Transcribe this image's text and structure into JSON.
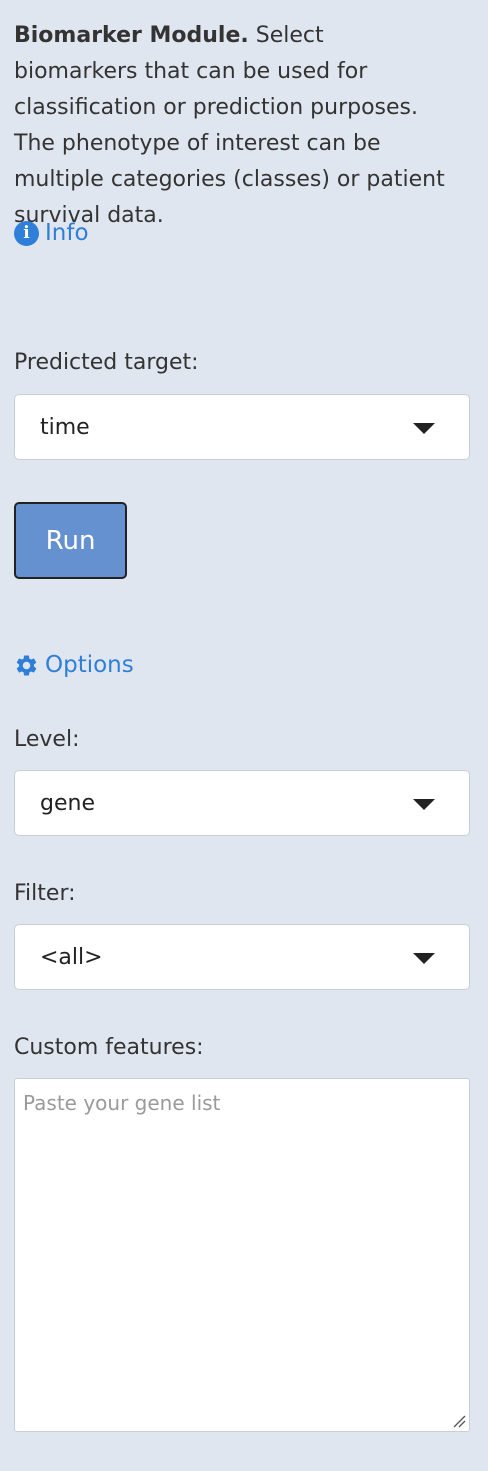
{
  "intro": {
    "title": "Biomarker Module.",
    "text": " Select biomarkers that can be used for classification or prediction purposes. The phenotype of interest can be multiple categories (classes) or patient survival data."
  },
  "info_link": {
    "icon": "info-icon",
    "label": "Info"
  },
  "predicted_target": {
    "label": "Predicted target:",
    "value": "time"
  },
  "run_button": {
    "label": "Run"
  },
  "options_link": {
    "icon": "gear-icon",
    "label": "Options"
  },
  "level": {
    "label": "Level:",
    "value": "gene"
  },
  "filter": {
    "label": "Filter:",
    "value": "<all>"
  },
  "custom_features": {
    "label": "Custom features:",
    "placeholder": "Paste your gene list",
    "value": ""
  },
  "colors": {
    "link": "#2f7fd8",
    "button": "#6691d1",
    "background": "#e0e6f0"
  }
}
